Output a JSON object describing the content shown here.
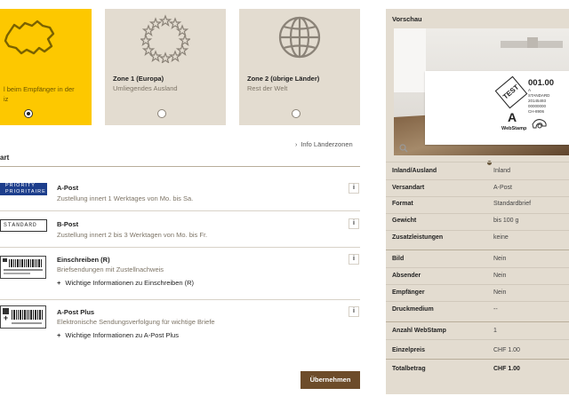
{
  "zones": [
    {
      "title": "",
      "subtitle": "l beim Empfänger in der\niz",
      "selected": true
    },
    {
      "title": "Zone 1 (Europa)",
      "subtitle": "Umliegendes Ausland",
      "selected": false
    },
    {
      "title": "Zone 2 (übrige Länder)",
      "subtitle": "Rest der Welt",
      "selected": false
    }
  ],
  "info_zones_label": "Info Länderzonen",
  "section_title": "art",
  "options": [
    {
      "logo": "PRIORITY\nPRIORITAIRE",
      "title": "A-Post",
      "desc": "Zustellung innert 1 Werktages von Mo. bis Sa.",
      "more": ""
    },
    {
      "logo": "STANDARD",
      "title": "B-Post",
      "desc": "Zustellung innert 2 bis 3 Werktagen von Mo. bis Fr.",
      "more": ""
    },
    {
      "logo": "",
      "title": "Einschreiben (R)",
      "desc": "Briefsendungen mit Zustellnachweis",
      "more": "Wichtige Informationen zu Einschreiben (R)"
    },
    {
      "logo": "",
      "title": "A-Post Plus",
      "desc": "Elektronische Sendungsverfolgung für wichtige Briefe",
      "more": "Wichtige Informationen zu A-Post Plus"
    }
  ],
  "info_button": "i",
  "apply_button": "Übernehmen",
  "preview": {
    "title": "Vorschau",
    "stamp": {
      "test": "TEST",
      "number": "001.00",
      "code_lines": [
        "A",
        "STANDARD",
        "20145493",
        "00000000",
        "CH-8906"
      ],
      "letter": "A",
      "brand": "WebStamp"
    },
    "rows": [
      {
        "label": "Inland/Ausland",
        "value": "Inland"
      },
      {
        "label": "Versandart",
        "value": "A-Post"
      },
      {
        "label": "Format",
        "value": "Standardbrief"
      },
      {
        "label": "Gewicht",
        "value": "bis 100 g"
      },
      {
        "label": "Zusatzleistungen",
        "value": "keine"
      },
      {
        "label": "Bild",
        "value": "Nein"
      },
      {
        "label": "Absender",
        "value": "Nein"
      },
      {
        "label": "Empfänger",
        "value": "Nein"
      },
      {
        "label": "Druckmedium",
        "value": "--"
      },
      {
        "label": "Anzahl WebStamp",
        "value": "1"
      },
      {
        "label": "Einzelpreis",
        "value": "CHF 1.00"
      },
      {
        "label": "Totalbetrag",
        "value": "CHF 1.00"
      }
    ]
  },
  "colors": {
    "accent_yellow": "#fdc800",
    "panel_beige": "#e3dcd0",
    "button_brown": "#6d4c2a",
    "priority_blue": "#1d3e8c"
  }
}
